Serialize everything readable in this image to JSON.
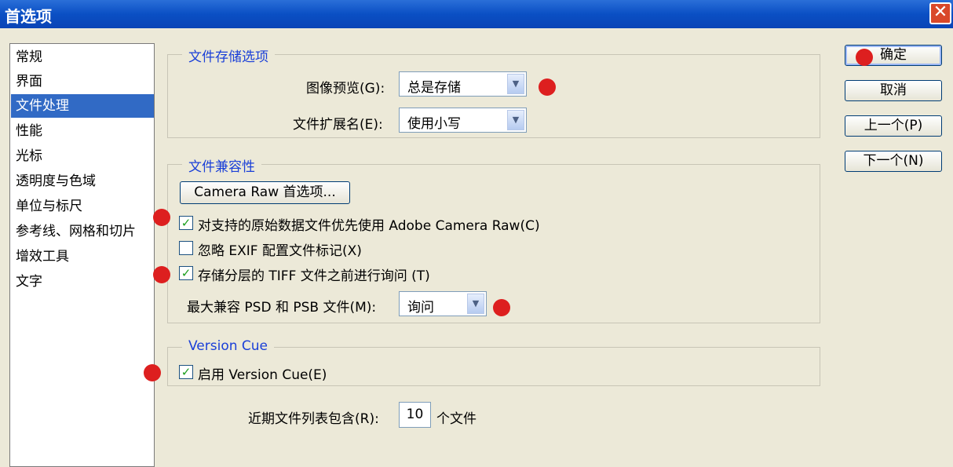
{
  "window": {
    "title": "首选项",
    "close_icon": "close-icon"
  },
  "sidebar": {
    "items": [
      {
        "label": "常规"
      },
      {
        "label": "界面"
      },
      {
        "label": "文件处理",
        "selected": true
      },
      {
        "label": "性能"
      },
      {
        "label": "光标"
      },
      {
        "label": "透明度与色域"
      },
      {
        "label": "单位与标尺"
      },
      {
        "label": "参考线、网格和切片"
      },
      {
        "label": "增效工具"
      },
      {
        "label": "文字"
      }
    ]
  },
  "file_save": {
    "legend": "文件存储选项",
    "image_preview_label": "图像预览(G):",
    "image_preview_value": "总是存储",
    "extension_label": "文件扩展名(E):",
    "extension_value": "使用小写"
  },
  "compat": {
    "legend": "文件兼容性",
    "camera_raw_button": "Camera Raw 首选项...",
    "prefer_acr_label": "对支持的原始数据文件优先使用 Adobe Camera Raw(C)",
    "prefer_acr_checked": true,
    "ignore_exif_label": "忽略 EXIF 配置文件标记(X)",
    "ignore_exif_checked": false,
    "ask_tiff_label": "存储分层的 TIFF 文件之前进行询问 (T)",
    "ask_tiff_checked": true,
    "maximize_label": "最大兼容 PSD 和 PSB 文件(M):",
    "maximize_value": "询问"
  },
  "version_cue": {
    "legend": "Version Cue",
    "enable_label": "启用 Version Cue(E)",
    "enable_checked": true
  },
  "recent": {
    "prefix": "近期文件列表包含(R):",
    "value": "10",
    "suffix": "个文件"
  },
  "buttons": {
    "ok": "确定",
    "cancel": "取消",
    "prev": "上一个(P)",
    "next": "下一个(N)"
  },
  "checkmark": "✓",
  "combo_arrow_icon": "chevron-down-icon",
  "annotation_color": "#dd1f1f"
}
